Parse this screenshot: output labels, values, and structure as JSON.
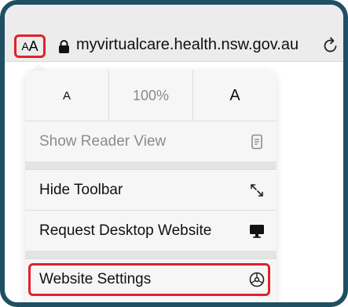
{
  "address_bar": {
    "aa_small": "A",
    "aa_big": "A",
    "url": "myvirtualcare.health.nsw.gov.au"
  },
  "menu": {
    "zoom": {
      "decrease_label": "A",
      "level": "100%",
      "increase_label": "A"
    },
    "reader_view": "Show Reader View",
    "hide_toolbar": "Hide Toolbar",
    "request_desktop": "Request Desktop Website",
    "website_settings": "Website Settings"
  },
  "colors": {
    "frame": "#1f4f63",
    "highlight": "#e0222b"
  },
  "icons": {
    "lock": "lock-icon",
    "reload": "reload-icon",
    "reader": "document-icon",
    "hide_toolbar": "diagonal-arrows-icon",
    "desktop": "monitor-icon",
    "settings": "gear-icon"
  }
}
